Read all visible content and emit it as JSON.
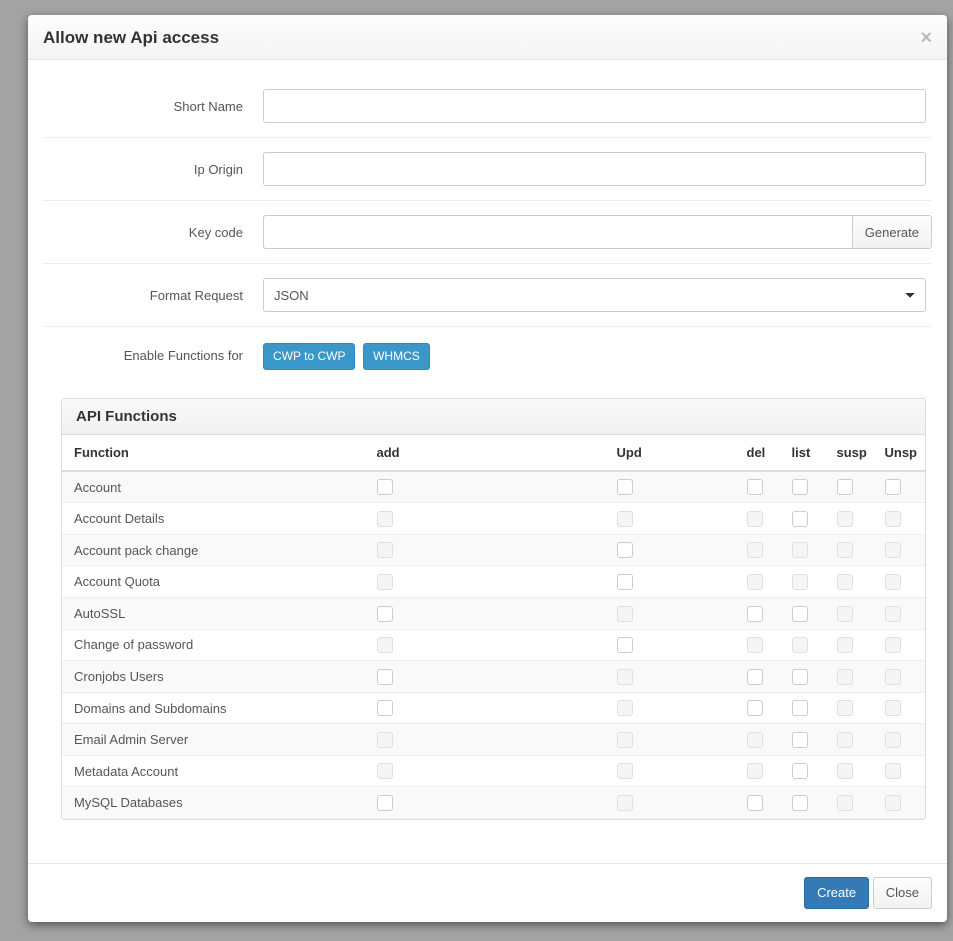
{
  "modal": {
    "title": "Allow new Api access"
  },
  "form": {
    "short_name_label": "Short Name",
    "short_name_value": "",
    "ip_origin_label": "Ip Origin",
    "ip_origin_value": "",
    "key_code_label": "Key code",
    "key_code_value": "",
    "generate_label": "Generate",
    "format_request_label": "Format Request",
    "format_request_value": "JSON",
    "enable_functions_label": "Enable Functions for",
    "btn_cwp_to_cwp": "CWP to CWP",
    "btn_whmcs": "WHMCS"
  },
  "functions_panel": {
    "title": "API Functions",
    "columns": {
      "function": "Function",
      "add": "add",
      "upd": "Upd",
      "del": "del",
      "list": "list",
      "susp": "susp",
      "unsp": "Unsp"
    },
    "rows": [
      {
        "name": "Account",
        "caps": {
          "add": true,
          "upd": true,
          "del": true,
          "list": true,
          "susp": true,
          "unsp": true
        }
      },
      {
        "name": "Account Details",
        "caps": {
          "add": false,
          "upd": false,
          "del": false,
          "list": true,
          "susp": false,
          "unsp": false
        }
      },
      {
        "name": "Account pack change",
        "caps": {
          "add": false,
          "upd": true,
          "del": false,
          "list": false,
          "susp": false,
          "unsp": false
        }
      },
      {
        "name": "Account Quota",
        "caps": {
          "add": false,
          "upd": true,
          "del": false,
          "list": false,
          "susp": false,
          "unsp": false
        }
      },
      {
        "name": "AutoSSL",
        "caps": {
          "add": true,
          "upd": false,
          "del": true,
          "list": true,
          "susp": false,
          "unsp": false
        }
      },
      {
        "name": "Change of password",
        "caps": {
          "add": false,
          "upd": true,
          "del": false,
          "list": false,
          "susp": false,
          "unsp": false
        }
      },
      {
        "name": "Cronjobs Users",
        "caps": {
          "add": true,
          "upd": false,
          "del": true,
          "list": true,
          "susp": false,
          "unsp": false
        }
      },
      {
        "name": "Domains and Subdomains",
        "caps": {
          "add": true,
          "upd": false,
          "del": true,
          "list": true,
          "susp": false,
          "unsp": false
        }
      },
      {
        "name": "Email Admin Server",
        "caps": {
          "add": false,
          "upd": false,
          "del": false,
          "list": true,
          "susp": false,
          "unsp": false
        }
      },
      {
        "name": "Metadata Account",
        "caps": {
          "add": false,
          "upd": false,
          "del": false,
          "list": true,
          "susp": false,
          "unsp": false
        }
      },
      {
        "name": "MySQL Databases",
        "caps": {
          "add": true,
          "upd": false,
          "del": true,
          "list": true,
          "susp": false,
          "unsp": false
        }
      }
    ]
  },
  "footer": {
    "create_label": "Create",
    "close_label": "Close"
  }
}
